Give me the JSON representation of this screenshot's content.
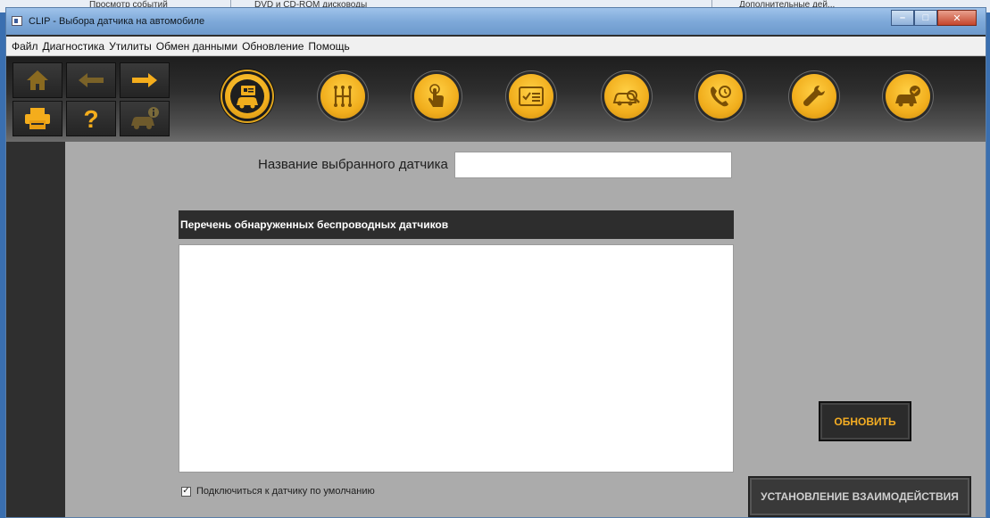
{
  "background": {
    "items": [
      "Просмотр событий",
      "DVD и CD-ROM дисководы",
      "Дополнительные дей..."
    ]
  },
  "window": {
    "title": "CLIP - Выбора датчика на автомобиле",
    "minimize": "–",
    "maximize": "□",
    "close": "✕"
  },
  "menu": {
    "items": [
      "Файл",
      "Диагностика",
      "Утилиты",
      "Обмен данными",
      "Обновление",
      "Помощь"
    ]
  },
  "toolbar": {
    "left_buttons": [
      "home-icon",
      "back-arrow-icon",
      "forward-arrow-icon",
      "printer-icon",
      "help-icon",
      "vehicle-info-icon"
    ],
    "circle_buttons": [
      "vehicle-id-icon",
      "gearbox-icon",
      "touch-icon",
      "checklist-icon",
      "vehicle-scan-icon",
      "phone-support-icon",
      "wrench-icon",
      "vehicle-check-icon"
    ],
    "active_index": 0,
    "accent": "#f1ae1d"
  },
  "form": {
    "sensor_name_label": "Название выбранного датчика",
    "sensor_name_value": "",
    "list_header": "Перечень обнаруженных беспроводных датчиков",
    "list_items": [],
    "default_checkbox_label": "Подключиться к датчику по умолчанию",
    "default_checkbox_checked": true
  },
  "buttons": {
    "refresh": "ОБНОВИТЬ",
    "connect": "УСТАНОВЛЕНИЕ ВЗАИМОДЕЙСТВИЯ"
  }
}
